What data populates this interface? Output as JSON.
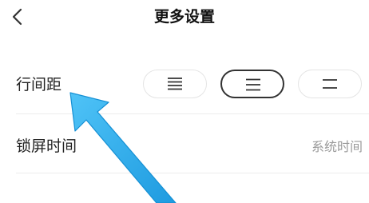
{
  "header": {
    "title": "更多设置",
    "back_icon": "chevron-left-icon"
  },
  "line_spacing": {
    "label": "行间距",
    "options": [
      {
        "icon": "line-spacing-compact-icon",
        "selected": false
      },
      {
        "icon": "line-spacing-standard-icon",
        "selected": true
      },
      {
        "icon": "line-spacing-loose-icon",
        "selected": false
      }
    ]
  },
  "lock_screen": {
    "label": "锁屏时间",
    "value": "系统时间"
  },
  "annotation": {
    "icon": "pointer-arrow-icon",
    "color": "#29a9ee"
  }
}
